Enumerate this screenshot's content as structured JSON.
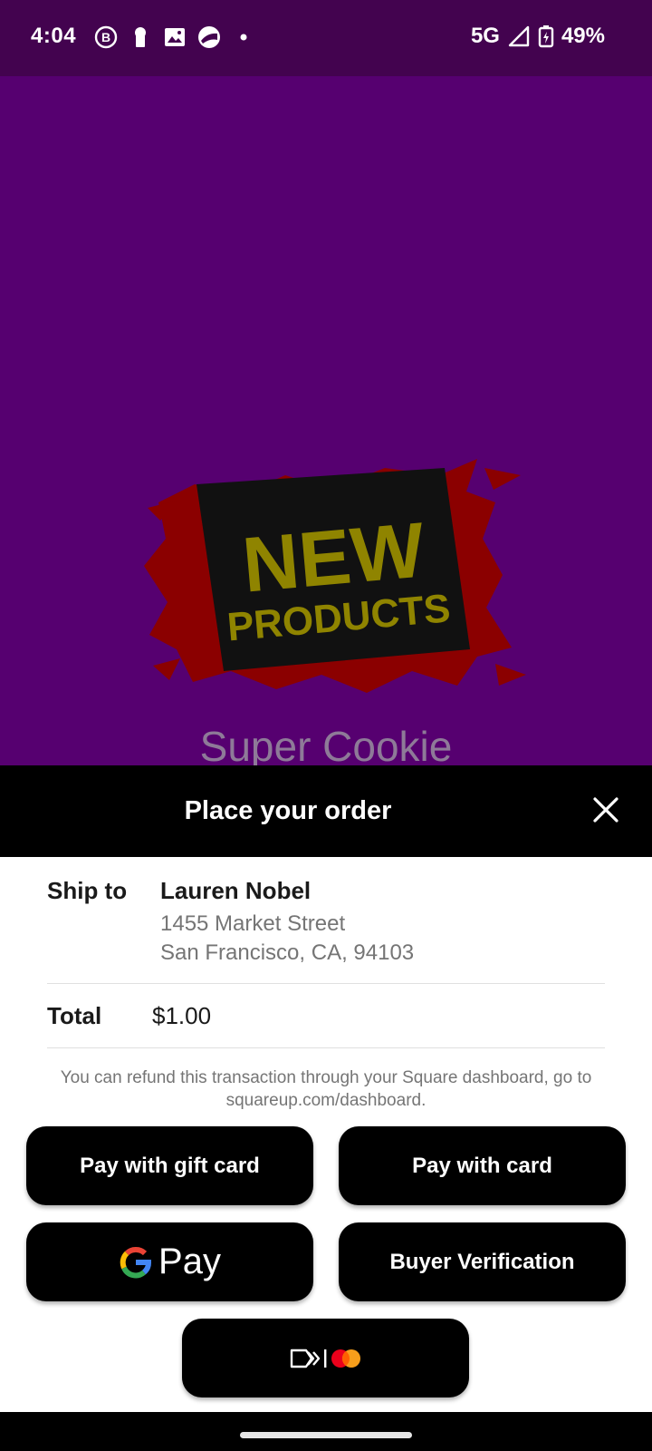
{
  "status_bar": {
    "time": "4:04",
    "left_icons": [
      "business-b-icon",
      "keyhole-icon",
      "photo-icon",
      "weather-icon",
      "dot-icon"
    ],
    "network": "5G",
    "battery": "49%"
  },
  "hero": {
    "promo_line1": "NEW",
    "promo_line2": "PRODUCTS",
    "title": "Super Cookie",
    "colors": {
      "background": "#560070",
      "splash": "#8b0000",
      "promo_text": "#8f8400"
    }
  },
  "order_sheet": {
    "title": "Place your order",
    "close_icon": "close-icon",
    "ship_to_label": "Ship to",
    "ship_name": "Lauren Nobel",
    "address_line1": "1455 Market Street",
    "address_line2": "San Francisco, CA, 94103",
    "total_label": "Total",
    "total_value": "$1.00",
    "refund_note": "You can refund this transaction through your Square dashboard, go to squareup.com/dashboard."
  },
  "buttons": {
    "gift_card": "Pay with gift card",
    "card": "Pay with card",
    "google_pay": "Pay",
    "buyer_verification": "Buyer Verification",
    "click_to_pay_icons": [
      "click-to-pay-icon",
      "mastercard-icon"
    ]
  }
}
